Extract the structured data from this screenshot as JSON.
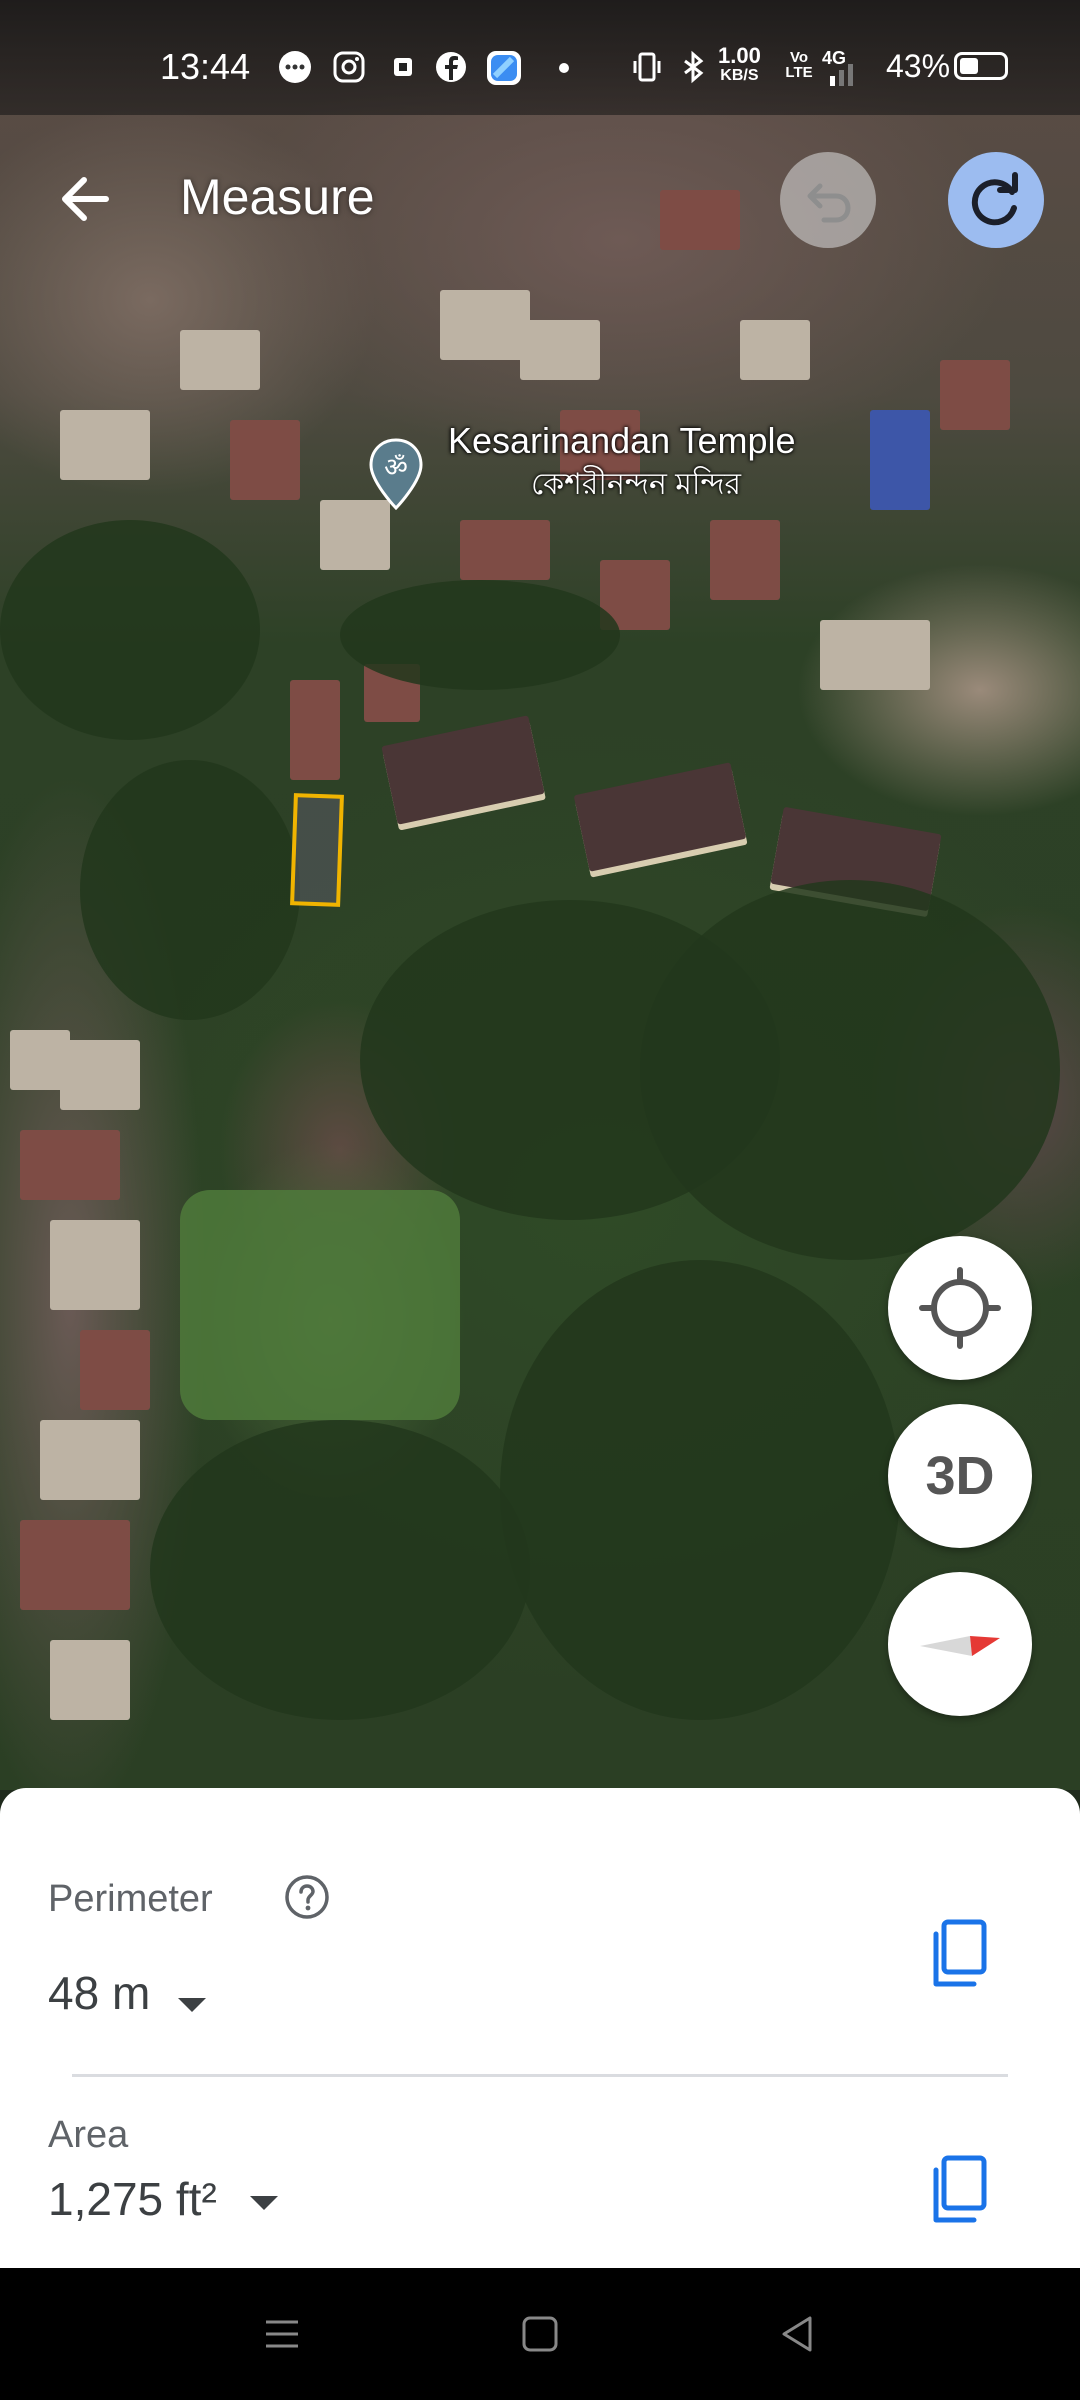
{
  "status_bar": {
    "time": "13:44",
    "net_speed_value": "1.00",
    "net_speed_unit": "KB/S",
    "volte": "Vo LTE",
    "network": "4G",
    "battery": "43%",
    "battery_level": 0.43,
    "icons": [
      "chat-icon",
      "instagram-icon",
      "notification-icon",
      "facebook-icon",
      "app-icon",
      "dot-icon",
      "vibrate-icon",
      "bluetooth-icon",
      "signal-icon"
    ]
  },
  "header": {
    "title": "Measure",
    "back_icon": "back-arrow-icon",
    "undo_icon": "undo-icon",
    "redo_icon": "redo-icon"
  },
  "map": {
    "place_name": "Kesarinandan Temple",
    "place_name_local": "কেশরীনন্দন মন্দির",
    "place_icon": "om-temple-pin-icon",
    "polygon_color": "#f0b400"
  },
  "controls": {
    "location_icon": "my-location-icon",
    "threed_label": "3D",
    "compass_icon": "compass-icon"
  },
  "measurement": {
    "perimeter_label": "Perimeter",
    "perimeter_value": "48 m",
    "area_label": "Area",
    "area_value": "1,275 ft²",
    "help_icon": "help-icon",
    "copy_icon": "copy-icon",
    "accent": "#1a73e8"
  },
  "nav_bar": {
    "icons": [
      "menu-icon",
      "home-icon",
      "back-icon"
    ]
  }
}
